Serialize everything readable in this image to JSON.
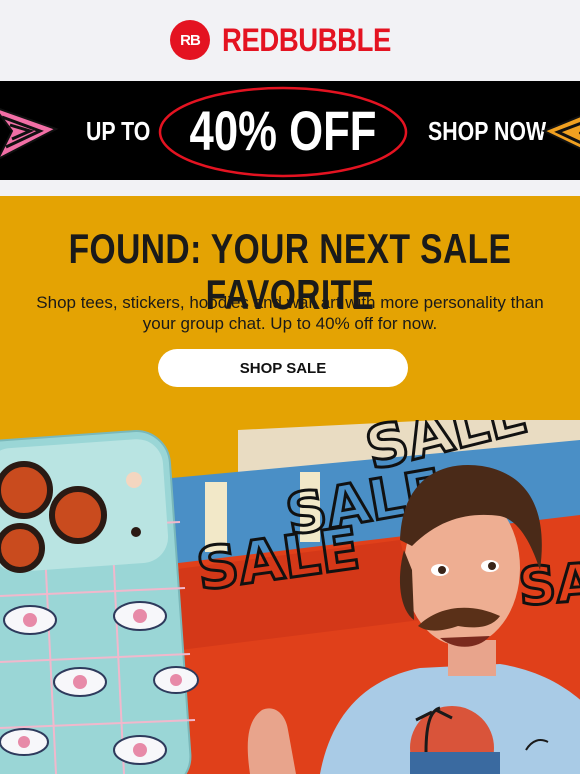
{
  "header": {
    "logo_mark": "RB",
    "brand_name": "REDBUBBLE",
    "brand_color": "#e41321"
  },
  "promo_bar": {
    "prefix": "UP TO",
    "discount": "40% OFF",
    "cta": "SHOP NOW",
    "background": "#000000",
    "ellipse_color": "#e41321"
  },
  "hero": {
    "headline": "FOUND: YOUR NEXT SALE FAVORITE",
    "subtext_line1": "Shop tees, stickers, hoodies and wall art with more personality than",
    "subtext_line2": "your group chat. Up to 40% off for now.",
    "button_label": "SHOP SALE",
    "background": "#e4a303"
  },
  "artwork": {
    "sale_words": [
      "SALE",
      "SALE",
      "SALE",
      "SALE"
    ],
    "items": [
      "phone-case-eyes-pattern",
      "man-in-sunset-tee"
    ]
  }
}
